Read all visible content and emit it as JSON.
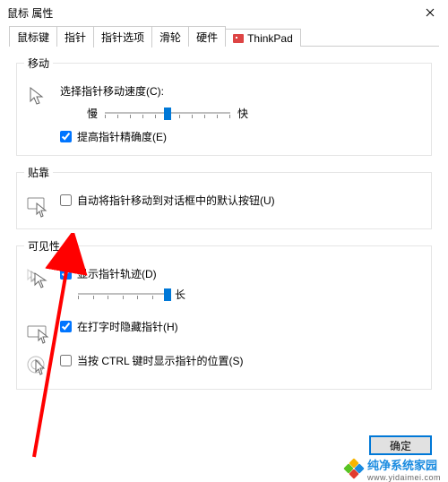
{
  "window": {
    "title": "鼠标 属性",
    "close_icon": "close-icon"
  },
  "tabs": [
    {
      "label": "鼠标键"
    },
    {
      "label": "指针"
    },
    {
      "label": "指针选项",
      "active": true
    },
    {
      "label": "滑轮"
    },
    {
      "label": "硬件"
    },
    {
      "label": "ThinkPad",
      "icon": "thinkpad-icon"
    }
  ],
  "groups": {
    "motion": {
      "legend": "移动",
      "speed_label": "选择指针移动速度(C):",
      "speed_slow": "慢",
      "speed_fast": "快",
      "speed_slider": {
        "ticks": 11,
        "value_index": 5
      },
      "precision_label": "提高指针精确度(E)",
      "precision_checked": true
    },
    "snap": {
      "legend": "贴靠",
      "snap_label": "自动将指针移动到对话框中的默认按钮(U)",
      "snap_checked": false
    },
    "visibility": {
      "legend": "可见性",
      "trails_label": "显示指针轨迹(D)",
      "trails_checked": true,
      "trails_slider": {
        "ticks": 7,
        "value_index": 6,
        "end_label": "长"
      },
      "hide_typing_label": "在打字时隐藏指针(H)",
      "hide_typing_checked": true,
      "ctrl_locate_label": "当按 CTRL 键时显示指针的位置(S)",
      "ctrl_locate_checked": false
    }
  },
  "buttons": {
    "ok": "确定"
  },
  "watermark": {
    "brand": "纯净系统家园",
    "url": "www.yidaimei.com"
  }
}
